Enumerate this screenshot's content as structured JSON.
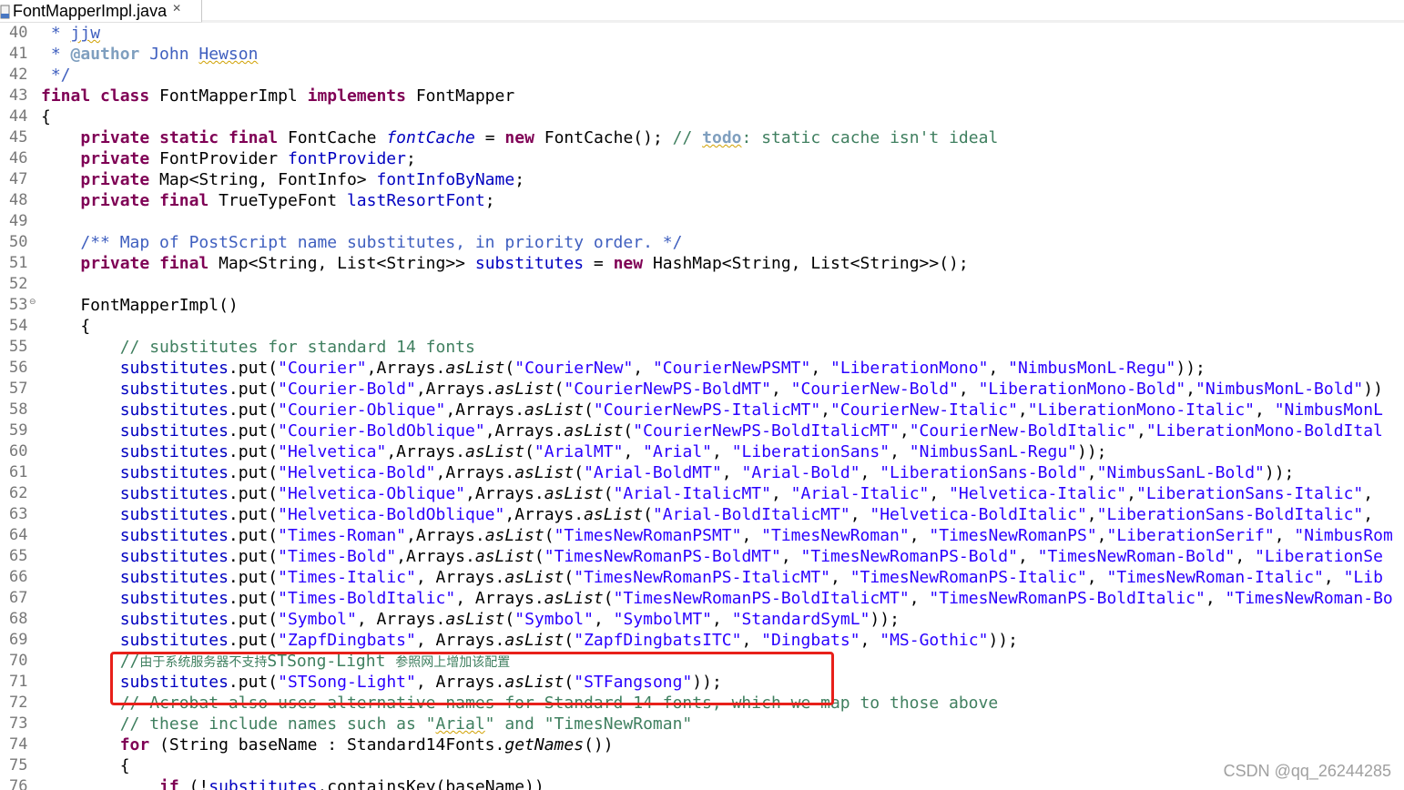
{
  "tab": {
    "title": "FontMapperImpl.java",
    "close": "✕",
    "icon": "java-file-icon"
  },
  "watermark": "CSDN @qq_26244285",
  "highlight_color": "#e8201a",
  "lines": [
    {
      "n": "40",
      "tokens": [
        [
          "jd",
          " * "
        ],
        [
          "jd sq",
          "jjw"
        ]
      ]
    },
    {
      "n": "41",
      "tokens": [
        [
          "jd",
          " * "
        ],
        [
          "jdt",
          "@author"
        ],
        [
          "jd",
          " John "
        ],
        [
          "jd sq",
          "Hewson"
        ]
      ]
    },
    {
      "n": "42",
      "tokens": [
        [
          "jd",
          " */"
        ]
      ]
    },
    {
      "n": "43",
      "tokens": [
        [
          "kw",
          "final"
        ],
        [
          "",
          "&nbsp;"
        ],
        [
          "kw",
          "class"
        ],
        [
          "",
          " FontMapperImpl "
        ],
        [
          "kw",
          "implements"
        ],
        [
          "",
          " FontMapper"
        ]
      ]
    },
    {
      "n": "44",
      "tokens": [
        [
          "",
          "{"
        ]
      ]
    },
    {
      "n": "45",
      "tokens": [
        [
          "",
          "    "
        ],
        [
          "kw",
          "private"
        ],
        [
          "",
          " "
        ],
        [
          "kw",
          "static"
        ],
        [
          "",
          " "
        ],
        [
          "kw",
          "final"
        ],
        [
          "",
          " FontCache "
        ],
        [
          "sfld",
          "fontCache"
        ],
        [
          "",
          " = "
        ],
        [
          "kw",
          "new"
        ],
        [
          "",
          " FontCache(); "
        ],
        [
          "cmt",
          "// "
        ],
        [
          "todo sq",
          "todo"
        ],
        [
          "cmt",
          ": static cache isn't ideal"
        ]
      ]
    },
    {
      "n": "46",
      "tokens": [
        [
          "",
          "    "
        ],
        [
          "kw",
          "private"
        ],
        [
          "",
          " FontProvider "
        ],
        [
          "fld",
          "fontProvider"
        ],
        [
          "",
          ";"
        ]
      ]
    },
    {
      "n": "47",
      "tokens": [
        [
          "",
          "    "
        ],
        [
          "kw",
          "private"
        ],
        [
          "",
          " Map<String, FontInfo> "
        ],
        [
          "fld",
          "fontInfoByName"
        ],
        [
          "",
          ";"
        ]
      ]
    },
    {
      "n": "48",
      "tokens": [
        [
          "",
          "    "
        ],
        [
          "kw",
          "private"
        ],
        [
          "",
          " "
        ],
        [
          "kw",
          "final"
        ],
        [
          "",
          " TrueTypeFont "
        ],
        [
          "fld",
          "lastResortFont"
        ],
        [
          "",
          ";"
        ]
      ]
    },
    {
      "n": "49",
      "tokens": []
    },
    {
      "n": "50",
      "tokens": [
        [
          "",
          "    "
        ],
        [
          "jd",
          "/** Map of PostScript name substitutes, in priority order. */"
        ]
      ]
    },
    {
      "n": "51",
      "tokens": [
        [
          "",
          "    "
        ],
        [
          "kw",
          "private"
        ],
        [
          "",
          " "
        ],
        [
          "kw",
          "final"
        ],
        [
          "",
          " Map<String, List<String>> "
        ],
        [
          "fld",
          "substitutes"
        ],
        [
          "",
          " = "
        ],
        [
          "kw",
          "new"
        ],
        [
          "",
          " HashMap<String, List<String>>();"
        ]
      ]
    },
    {
      "n": "52",
      "tokens": []
    },
    {
      "n": "53",
      "fold": "⊖",
      "tokens": [
        [
          "",
          "    FontMapperImpl()"
        ]
      ]
    },
    {
      "n": "54",
      "tokens": [
        [
          "",
          "    {"
        ]
      ]
    },
    {
      "n": "55",
      "tokens": [
        [
          "",
          "        "
        ],
        [
          "cmt",
          "// substitutes for standard 14 fonts"
        ]
      ]
    },
    {
      "n": "56",
      "tokens": [
        [
          "",
          "        "
        ],
        [
          "fld",
          "substitutes"
        ],
        [
          "",
          ".put("
        ],
        [
          "str",
          "\"Courier\""
        ],
        [
          "",
          ",Arrays."
        ],
        [
          "mth",
          "asList"
        ],
        [
          "",
          "("
        ],
        [
          "str",
          "\"CourierNew\""
        ],
        [
          "",
          ", "
        ],
        [
          "str",
          "\"CourierNewPSMT\""
        ],
        [
          "",
          ", "
        ],
        [
          "str",
          "\"LiberationMono\""
        ],
        [
          "",
          ", "
        ],
        [
          "str",
          "\"NimbusMonL-Regu\""
        ],
        [
          "",
          "));"
        ]
      ]
    },
    {
      "n": "57",
      "tokens": [
        [
          "",
          "        "
        ],
        [
          "fld",
          "substitutes"
        ],
        [
          "",
          ".put("
        ],
        [
          "str",
          "\"Courier-Bold\""
        ],
        [
          "",
          ",Arrays."
        ],
        [
          "mth",
          "asList"
        ],
        [
          "",
          "("
        ],
        [
          "str",
          "\"CourierNewPS-BoldMT\""
        ],
        [
          "",
          ", "
        ],
        [
          "str",
          "\"CourierNew-Bold\""
        ],
        [
          "",
          ", "
        ],
        [
          "str",
          "\"LiberationMono-Bold\""
        ],
        [
          "",
          ","
        ],
        [
          "str",
          "\"NimbusMonL-Bold\""
        ],
        [
          "",
          "))"
        ]
      ]
    },
    {
      "n": "58",
      "tokens": [
        [
          "",
          "        "
        ],
        [
          "fld",
          "substitutes"
        ],
        [
          "",
          ".put("
        ],
        [
          "str",
          "\"Courier-Oblique\""
        ],
        [
          "",
          ",Arrays."
        ],
        [
          "mth",
          "asList"
        ],
        [
          "",
          "("
        ],
        [
          "str",
          "\"CourierNewPS-ItalicMT\""
        ],
        [
          "",
          ","
        ],
        [
          "str",
          "\"CourierNew-Italic\""
        ],
        [
          "",
          ","
        ],
        [
          "str",
          "\"LiberationMono-Italic\""
        ],
        [
          "",
          ", "
        ],
        [
          "str",
          "\"NimbusMonL"
        ]
      ]
    },
    {
      "n": "59",
      "tokens": [
        [
          "",
          "        "
        ],
        [
          "fld",
          "substitutes"
        ],
        [
          "",
          ".put("
        ],
        [
          "str",
          "\"Courier-BoldOblique\""
        ],
        [
          "",
          ",Arrays."
        ],
        [
          "mth",
          "asList"
        ],
        [
          "",
          "("
        ],
        [
          "str",
          "\"CourierNewPS-BoldItalicMT\""
        ],
        [
          "",
          ","
        ],
        [
          "str",
          "\"CourierNew-BoldItalic\""
        ],
        [
          "",
          ","
        ],
        [
          "str",
          "\"LiberationMono-BoldItal"
        ]
      ]
    },
    {
      "n": "60",
      "tokens": [
        [
          "",
          "        "
        ],
        [
          "fld",
          "substitutes"
        ],
        [
          "",
          ".put("
        ],
        [
          "str",
          "\"Helvetica\""
        ],
        [
          "",
          ",Arrays."
        ],
        [
          "mth",
          "asList"
        ],
        [
          "",
          "("
        ],
        [
          "str",
          "\"ArialMT\""
        ],
        [
          "",
          ", "
        ],
        [
          "str",
          "\"Arial\""
        ],
        [
          "",
          ", "
        ],
        [
          "str",
          "\"LiberationSans\""
        ],
        [
          "",
          ", "
        ],
        [
          "str",
          "\"NimbusSanL-Regu\""
        ],
        [
          "",
          "));"
        ]
      ]
    },
    {
      "n": "61",
      "tokens": [
        [
          "",
          "        "
        ],
        [
          "fld",
          "substitutes"
        ],
        [
          "",
          ".put("
        ],
        [
          "str",
          "\"Helvetica-Bold\""
        ],
        [
          "",
          ",Arrays."
        ],
        [
          "mth",
          "asList"
        ],
        [
          "",
          "("
        ],
        [
          "str",
          "\"Arial-BoldMT\""
        ],
        [
          "",
          ", "
        ],
        [
          "str",
          "\"Arial-Bold\""
        ],
        [
          "",
          ", "
        ],
        [
          "str",
          "\"LiberationSans-Bold\""
        ],
        [
          "",
          ","
        ],
        [
          "str",
          "\"NimbusSanL-Bold\""
        ],
        [
          "",
          "));"
        ]
      ]
    },
    {
      "n": "62",
      "tokens": [
        [
          "",
          "        "
        ],
        [
          "fld",
          "substitutes"
        ],
        [
          "",
          ".put("
        ],
        [
          "str",
          "\"Helvetica-Oblique\""
        ],
        [
          "",
          ",Arrays."
        ],
        [
          "mth",
          "asList"
        ],
        [
          "",
          "("
        ],
        [
          "str",
          "\"Arial-ItalicMT\""
        ],
        [
          "",
          ", "
        ],
        [
          "str",
          "\"Arial-Italic\""
        ],
        [
          "",
          ", "
        ],
        [
          "str",
          "\"Helvetica-Italic\""
        ],
        [
          "",
          ","
        ],
        [
          "str",
          "\"LiberationSans-Italic\""
        ],
        [
          "",
          ","
        ]
      ]
    },
    {
      "n": "63",
      "tokens": [
        [
          "",
          "        "
        ],
        [
          "fld",
          "substitutes"
        ],
        [
          "",
          ".put("
        ],
        [
          "str",
          "\"Helvetica-BoldOblique\""
        ],
        [
          "",
          ",Arrays."
        ],
        [
          "mth",
          "asList"
        ],
        [
          "",
          "("
        ],
        [
          "str",
          "\"Arial-BoldItalicMT\""
        ],
        [
          "",
          ", "
        ],
        [
          "str",
          "\"Helvetica-BoldItalic\""
        ],
        [
          "",
          ","
        ],
        [
          "str",
          "\"LiberationSans-BoldItalic\""
        ],
        [
          "",
          ","
        ]
      ]
    },
    {
      "n": "64",
      "tokens": [
        [
          "",
          "        "
        ],
        [
          "fld",
          "substitutes"
        ],
        [
          "",
          ".put("
        ],
        [
          "str",
          "\"Times-Roman\""
        ],
        [
          "",
          ",Arrays."
        ],
        [
          "mth",
          "asList"
        ],
        [
          "",
          "("
        ],
        [
          "str",
          "\"TimesNewRomanPSMT\""
        ],
        [
          "",
          ", "
        ],
        [
          "str",
          "\"TimesNewRoman\""
        ],
        [
          "",
          ", "
        ],
        [
          "str",
          "\"TimesNewRomanPS\""
        ],
        [
          "",
          ","
        ],
        [
          "str",
          "\"LiberationSerif\""
        ],
        [
          "",
          ", "
        ],
        [
          "str",
          "\"NimbusRom"
        ]
      ]
    },
    {
      "n": "65",
      "tokens": [
        [
          "",
          "        "
        ],
        [
          "fld",
          "substitutes"
        ],
        [
          "",
          ".put("
        ],
        [
          "str",
          "\"Times-Bold\""
        ],
        [
          "",
          ",Arrays."
        ],
        [
          "mth",
          "asList"
        ],
        [
          "",
          "("
        ],
        [
          "str",
          "\"TimesNewRomanPS-BoldMT\""
        ],
        [
          "",
          ", "
        ],
        [
          "str",
          "\"TimesNewRomanPS-Bold\""
        ],
        [
          "",
          ", "
        ],
        [
          "str",
          "\"TimesNewRoman-Bold\""
        ],
        [
          "",
          ", "
        ],
        [
          "str",
          "\"LiberationSe"
        ]
      ]
    },
    {
      "n": "66",
      "tokens": [
        [
          "",
          "        "
        ],
        [
          "fld",
          "substitutes"
        ],
        [
          "",
          ".put("
        ],
        [
          "str",
          "\"Times-Italic\""
        ],
        [
          "",
          ", Arrays."
        ],
        [
          "mth",
          "asList"
        ],
        [
          "",
          "("
        ],
        [
          "str",
          "\"TimesNewRomanPS-ItalicMT\""
        ],
        [
          "",
          ", "
        ],
        [
          "str",
          "\"TimesNewRomanPS-Italic\""
        ],
        [
          "",
          ", "
        ],
        [
          "str",
          "\"TimesNewRoman-Italic\""
        ],
        [
          "",
          ", "
        ],
        [
          "str",
          "\"Lib"
        ]
      ]
    },
    {
      "n": "67",
      "tokens": [
        [
          "",
          "        "
        ],
        [
          "fld",
          "substitutes"
        ],
        [
          "",
          ".put("
        ],
        [
          "str",
          "\"Times-BoldItalic\""
        ],
        [
          "",
          ", Arrays."
        ],
        [
          "mth",
          "asList"
        ],
        [
          "",
          "("
        ],
        [
          "str",
          "\"TimesNewRomanPS-BoldItalicMT\""
        ],
        [
          "",
          ", "
        ],
        [
          "str",
          "\"TimesNewRomanPS-BoldItalic\""
        ],
        [
          "",
          ", "
        ],
        [
          "str",
          "\"TimesNewRoman-Bo"
        ]
      ]
    },
    {
      "n": "68",
      "tokens": [
        [
          "",
          "        "
        ],
        [
          "fld",
          "substitutes"
        ],
        [
          "",
          ".put("
        ],
        [
          "str",
          "\"Symbol\""
        ],
        [
          "",
          ", Arrays."
        ],
        [
          "mth",
          "asList"
        ],
        [
          "",
          "("
        ],
        [
          "str",
          "\"Symbol\""
        ],
        [
          "",
          ", "
        ],
        [
          "str",
          "\"SymbolMT\""
        ],
        [
          "",
          ", "
        ],
        [
          "str",
          "\"StandardSymL\""
        ],
        [
          "",
          "));"
        ]
      ]
    },
    {
      "n": "69",
      "tokens": [
        [
          "",
          "        "
        ],
        [
          "fld",
          "substitutes"
        ],
        [
          "",
          ".put("
        ],
        [
          "str",
          "\"ZapfDingbats\""
        ],
        [
          "",
          ", Arrays."
        ],
        [
          "mth",
          "asList"
        ],
        [
          "",
          "("
        ],
        [
          "str",
          "\"ZapfDingbatsITC\""
        ],
        [
          "",
          ", "
        ],
        [
          "str",
          "\"Dingbats\""
        ],
        [
          "",
          ", "
        ],
        [
          "str",
          "\"MS-Gothic\""
        ],
        [
          "",
          "));"
        ]
      ]
    },
    {
      "n": "70",
      "tokens": [
        [
          "",
          "        "
        ],
        [
          "cmt",
          "//"
        ],
        [
          "cmt cjk",
          "由于系统服务器不支持"
        ],
        [
          "cmt",
          "STSong-Light "
        ],
        [
          "cmt cjk",
          "参照网上增加该配置"
        ]
      ]
    },
    {
      "n": "71",
      "tokens": [
        [
          "",
          "        "
        ],
        [
          "fld",
          "substitutes"
        ],
        [
          "",
          ".put("
        ],
        [
          "str",
          "\"STSong-Light\""
        ],
        [
          "",
          ", Arrays."
        ],
        [
          "mth",
          "asList"
        ],
        [
          "",
          "("
        ],
        [
          "str",
          "\"STFangsong\""
        ],
        [
          "",
          "));"
        ]
      ]
    },
    {
      "n": "72",
      "tokens": [
        [
          "",
          "        "
        ],
        [
          "cmt",
          "// Acrobat also uses alternative names for Standard 14 fonts, which we map to those above"
        ]
      ]
    },
    {
      "n": "73",
      "tokens": [
        [
          "",
          "        "
        ],
        [
          "cmt",
          "// these include names such as \""
        ],
        [
          "cmt sq",
          "Arial"
        ],
        [
          "cmt",
          "\" and \"TimesNewRoman\""
        ]
      ]
    },
    {
      "n": "74",
      "tokens": [
        [
          "",
          "        "
        ],
        [
          "kw",
          "for"
        ],
        [
          "",
          " (String baseName : Standard14Fonts."
        ],
        [
          "mth",
          "getNames"
        ],
        [
          "",
          "())"
        ]
      ]
    },
    {
      "n": "75",
      "tokens": [
        [
          "",
          "        {"
        ]
      ]
    },
    {
      "n": "76",
      "tokens": [
        [
          "",
          "            "
        ],
        [
          "kw",
          "if"
        ],
        [
          "",
          " (!"
        ],
        [
          "fld",
          "substitutes"
        ],
        [
          "",
          ".containsKey(baseName))"
        ]
      ]
    }
  ]
}
